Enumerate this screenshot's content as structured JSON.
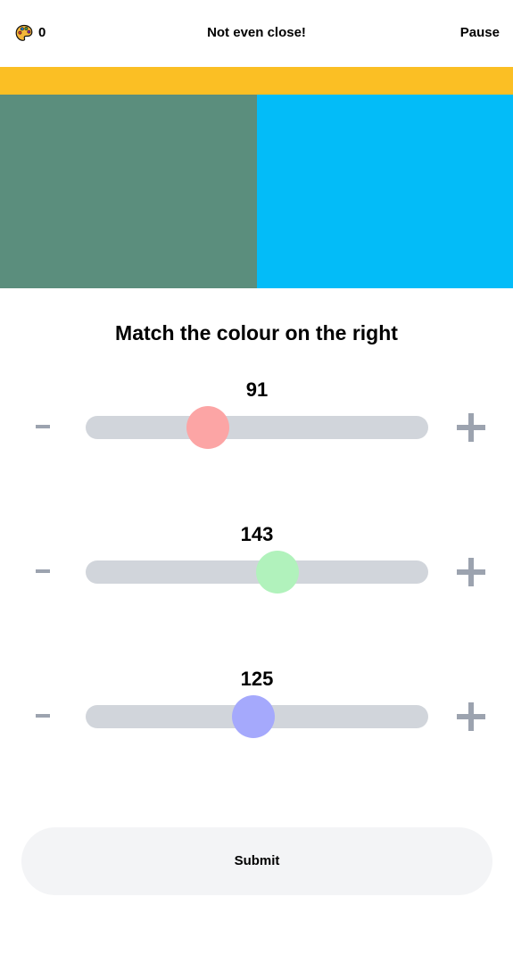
{
  "header": {
    "score_icon": "palette-icon",
    "score": "0",
    "feedback": "Not even close!",
    "pause_label": "Pause"
  },
  "colors": {
    "progress_bar": "#FBBF24",
    "guess_swatch": "#5B8E7D",
    "target_swatch": "#03BCF8",
    "track": "#D1D5DB",
    "stepper_icon": "#9CA3AF",
    "submit_bg": "#F3F4F6"
  },
  "prompt": "Match the colour on the right",
  "sliders": [
    {
      "channel": "red",
      "value": "91",
      "level": 0.357,
      "thumb_color": "#FCA5A5",
      "minus_icon": "minus-icon",
      "plus_icon": "plus-icon"
    },
    {
      "channel": "green",
      "value": "143",
      "level": 0.561,
      "thumb_color": "#B1F2BC",
      "minus_icon": "minus-icon",
      "plus_icon": "plus-icon"
    },
    {
      "channel": "blue",
      "value": "125",
      "level": 0.49,
      "thumb_color": "#A5A9FC",
      "minus_icon": "minus-icon",
      "plus_icon": "plus-icon"
    }
  ],
  "submit_label": "Submit"
}
